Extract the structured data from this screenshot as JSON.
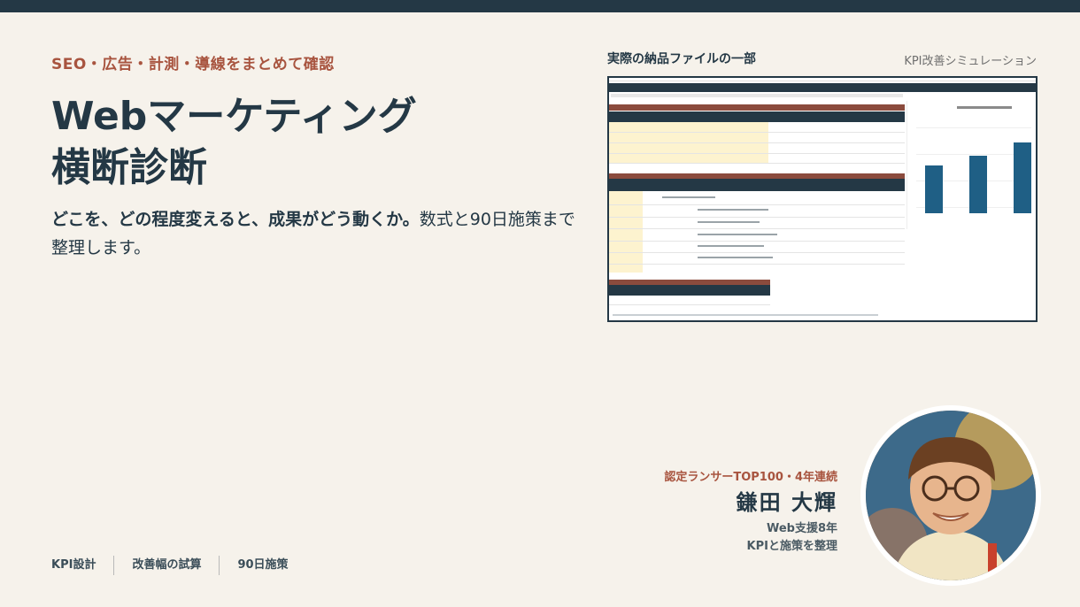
{
  "eyebrow": "SEO・広告・計測・導線をまとめて確認",
  "headline": {
    "line1": "Webマーケティング",
    "line2": "横断診断"
  },
  "lead": {
    "bold": "どこを、どの程度変えると、成果がどう動くか。",
    "rest": "数式と90日施策まで整理します。"
  },
  "sheet": {
    "title": "実際の納品ファイルの一部",
    "caption": "KPI改善シミュレーション"
  },
  "profile": {
    "kicker": "認定ランサーTOP100・4年連続",
    "name": "鎌田 大輝",
    "role_line1": "Web支援8年",
    "role_line2": "KPIと施策を整理"
  },
  "tags": [
    "KPI設計",
    "改善幅の試算",
    "90日施策"
  ],
  "colors": {
    "background": "#f6f2eb",
    "navy": "#243845",
    "accent": "#a8543f",
    "bar": "#1f5f85"
  }
}
